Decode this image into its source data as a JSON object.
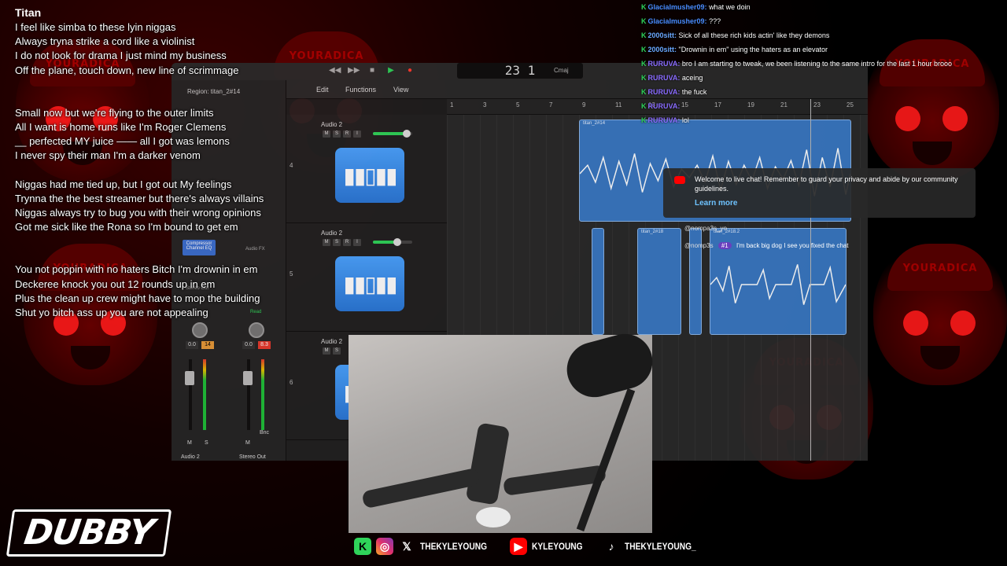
{
  "background": {
    "pattern_text": "YOURADICA",
    "accent": "#ff1a1a"
  },
  "lyrics": {
    "title": "Titan",
    "stanzas": [
      [
        "I feel like simba to these lyin niggas",
        "Always tryna strike a cord like a violinist",
        "I do not look for drama I just mind my business",
        "Off the plane, touch down, new line of scrimmage"
      ],
      [
        "Small now but we're flying to the outer limits",
        "All I want is home runs like I'm Roger Clemens",
        "__ perfected MY juice —— all I got was lemons",
        "I never spy  their man I'm a darker venom"
      ],
      [
        "Niggas had me tied up, but I got out My feelings",
        "Trynna the the best streamer  but there's always villains",
        "Niggas always try to bug you with their wrong opinions",
        "Got me sick like the Rona so I'm bound to get em"
      ],
      [
        "You not poppin with no haters Bitch I'm drownin in em",
        "Deckeree knock you out 12 rounds up in em",
        "Plus the clean up crew might have to mop the building",
        "Shut yo bitch ass up you are not appealing"
      ]
    ]
  },
  "chat": {
    "messages": [
      {
        "user": "Glacialmusher09:",
        "text": "what we doin",
        "color": "#4a8cff"
      },
      {
        "user": "Glacialmusher09:",
        "text": "???",
        "color": "#4a8cff"
      },
      {
        "user": "2000sitt:",
        "text": "Sick of all these rich kids actin' like they demons",
        "color": "#6aa8ff"
      },
      {
        "user": "2000sitt:",
        "text": "\"Drownin in em\" using the haters as an elevator",
        "color": "#6aa8ff"
      },
      {
        "user": "RURUVA:",
        "text": "bro I am starting to tweak, we been listening to the same intro for the last 1 hour brooo",
        "color": "#8a6cff"
      },
      {
        "user": "RURUVA:",
        "text": "aceing",
        "color": "#8a6cff"
      },
      {
        "user": "RURUVA:",
        "text": "the fuck",
        "color": "#8a6cff"
      },
      {
        "user": "RURUVA:",
        "text": "",
        "color": "#8a6cff"
      },
      {
        "user": "RURUVA:",
        "text": "lol",
        "color": "#8a6cff"
      }
    ]
  },
  "toast": {
    "message": "Welcome to live chat! Remember to guard your privacy and abide by our community guidelines.",
    "link": "Learn more"
  },
  "yt_chat": {
    "row1_user": "@nompa3s_yo",
    "row2_user": "@nomp3s",
    "row2_badge": "#1",
    "row2_text": "I'm back big dog I see you fixed the chat"
  },
  "daw": {
    "lcd": "23  1",
    "key": "Cmaj",
    "region_label": "Region: titan_2#14",
    "menus": [
      "Edit",
      "Functions",
      "View"
    ],
    "ruler": [
      "1",
      "3",
      "5",
      "7",
      "9",
      "11",
      "13",
      "15",
      "17",
      "19",
      "21",
      "23",
      "25"
    ],
    "tracks": [
      {
        "name": "Audio 2",
        "num": "4"
      },
      {
        "name": "Audio 2",
        "num": "5"
      },
      {
        "name": "Audio 2",
        "num": "6"
      }
    ],
    "msri": [
      "M",
      "S",
      "R",
      "I"
    ],
    "regions": [
      "titan_2#14",
      "titan_2#18",
      "titan_2#18.2",
      "titan_2#16"
    ],
    "plugins": [
      "Compressor",
      "Channel EQ"
    ],
    "audio_fx": "Audio FX",
    "stereo_out": "Stereo Out",
    "read": "Read",
    "ch1": {
      "name": "Audio 2",
      "val_a": "0.0",
      "val_b": "14"
    },
    "ch2": {
      "name": "Stereo Out",
      "val_a": "0.0",
      "val_b": "8.3"
    },
    "bnc": "Bnc",
    "m_label": "M",
    "s_label": "S"
  },
  "social": [
    {
      "icon": "kick-icon",
      "label": ""
    },
    {
      "icon": "instagram-icon",
      "label": ""
    },
    {
      "icon": "x-icon",
      "label": "THEKYLEYOUNG"
    },
    {
      "icon": "youtube-icon",
      "label": "KYLEYOUNG"
    },
    {
      "icon": "tiktok-icon",
      "label": "THEKYLEYOUNG_"
    }
  ],
  "logo": "DUBBY"
}
